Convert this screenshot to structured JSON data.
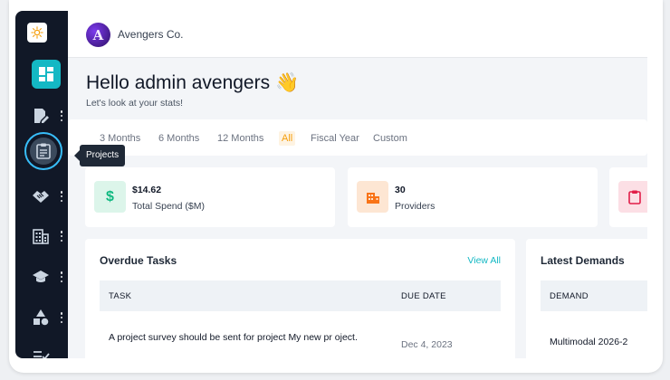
{
  "sidebar": {
    "tooltip": "Projects",
    "items": [
      {
        "icon": "dashboard-icon"
      },
      {
        "icon": "document-edit-icon"
      },
      {
        "icon": "clipboard-icon"
      },
      {
        "icon": "handshake-icon"
      },
      {
        "icon": "building-icon"
      },
      {
        "icon": "graduation-cap-icon"
      },
      {
        "icon": "shapes-icon"
      },
      {
        "icon": "checklist-icon"
      }
    ]
  },
  "header": {
    "company": "Avengers Co."
  },
  "greeting": {
    "title": "Hello admin avengers 👋",
    "subtitle": "Let's look at your stats!"
  },
  "filters": [
    "3 Months",
    "6 Months",
    "12 Months",
    "All",
    "Fiscal Year",
    "Custom"
  ],
  "stats": [
    {
      "value": "$14.62",
      "label": "Total Spend ($M)",
      "icon": "$",
      "color": "#10b981",
      "bg": "#dcf5ea"
    },
    {
      "value": "30",
      "label": "Providers",
      "icon": "building-icon",
      "color": "#f97316",
      "bg": "#fde6d3"
    },
    {
      "value": "",
      "label": "",
      "icon": "clipboard-icon",
      "color": "#e11d48",
      "bg": "#fcdfe5"
    }
  ],
  "overdue": {
    "title": "Overdue Tasks",
    "link": "View All",
    "columns": [
      "TASK",
      "DUE DATE"
    ],
    "rows": [
      {
        "task": "A project survey should be sent for project My new pr oject.",
        "due": "Dec 4, 2023"
      }
    ]
  },
  "demands": {
    "title": "Latest Demands",
    "columns": [
      "DEMAND"
    ],
    "rows": [
      {
        "demand": "Multimodal 2026-2"
      }
    ]
  }
}
